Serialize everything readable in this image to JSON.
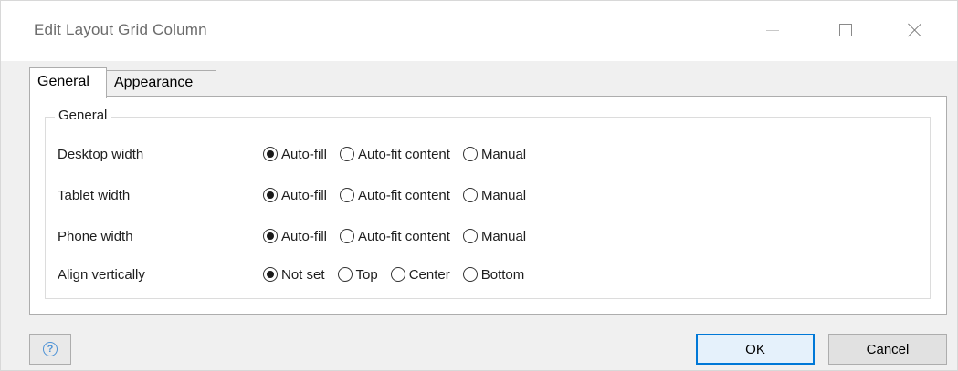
{
  "window": {
    "title": "Edit Layout Grid Column"
  },
  "tabs": [
    {
      "label": "General",
      "active": true
    },
    {
      "label": "Appearance",
      "active": false
    }
  ],
  "group": {
    "title": "General",
    "rows": [
      {
        "label": "Desktop width",
        "options": [
          "Auto-fill",
          "Auto-fit content",
          "Manual"
        ],
        "selected": "Auto-fill"
      },
      {
        "label": "Tablet width",
        "options": [
          "Auto-fill",
          "Auto-fit content",
          "Manual"
        ],
        "selected": "Auto-fill"
      },
      {
        "label": "Phone width",
        "options": [
          "Auto-fill",
          "Auto-fit content",
          "Manual"
        ],
        "selected": "Auto-fill"
      },
      {
        "label": "Align vertically",
        "options": [
          "Not set",
          "Top",
          "Center",
          "Bottom"
        ],
        "selected": "Not set"
      }
    ]
  },
  "footer": {
    "help_icon_glyph": "?",
    "ok_label": "OK",
    "cancel_label": "Cancel"
  },
  "icons": {
    "minimize": "minimize-icon",
    "maximize": "maximize-icon",
    "close": "close-icon",
    "help": "help-icon"
  },
  "colors": {
    "accent": "#0078d7",
    "help": "#4d92d6"
  }
}
